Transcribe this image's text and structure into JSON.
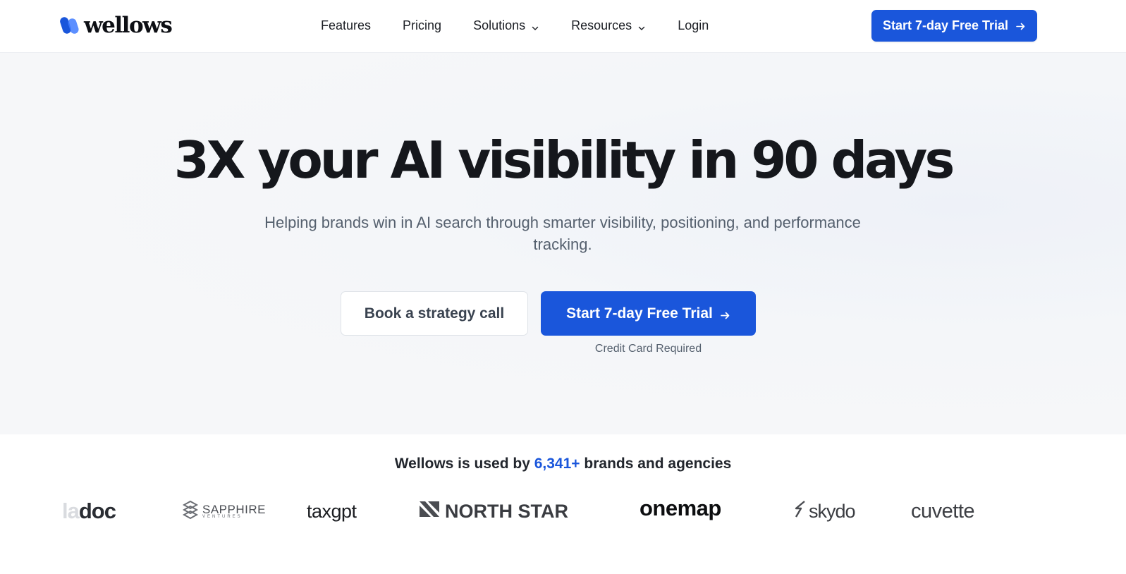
{
  "brand": {
    "name": "wellows",
    "accent_color": "#1a56db"
  },
  "nav": {
    "items": [
      {
        "label": "Features",
        "has_dropdown": false
      },
      {
        "label": "Pricing",
        "has_dropdown": false
      },
      {
        "label": "Solutions",
        "has_dropdown": true
      },
      {
        "label": "Resources",
        "has_dropdown": true
      },
      {
        "label": "Login",
        "has_dropdown": false
      }
    ],
    "cta_label": "Start 7-day Free Trial",
    "cta_icon": "arrow-right-icon"
  },
  "hero": {
    "title": "3X your AI visibility in 90 days",
    "subtitle": "Helping brands win in AI search through smarter visibility, positioning, and performance tracking.",
    "secondary_button": "Book a strategy call",
    "primary_button": "Start 7-day Free Trial",
    "primary_icon": "arrow-right-icon",
    "note": "Credit Card Required"
  },
  "brands": {
    "prefix": "Wellows is used by",
    "count": "6,341+",
    "suffix": "brands and agencies",
    "logos": [
      {
        "name": "ladoc",
        "text_faded": "la",
        "text": "doc"
      },
      {
        "name": "sapphire",
        "text": "SAPPHIRE",
        "subtext": "VENTURES"
      },
      {
        "name": "taxgpt",
        "text": "taxgpt"
      },
      {
        "name": "northstar",
        "text": "NORTH STAR"
      },
      {
        "name": "onemap",
        "text": "onemap"
      },
      {
        "name": "skydo",
        "text": "skydo"
      },
      {
        "name": "cuvette",
        "text": "cuvette"
      }
    ]
  }
}
